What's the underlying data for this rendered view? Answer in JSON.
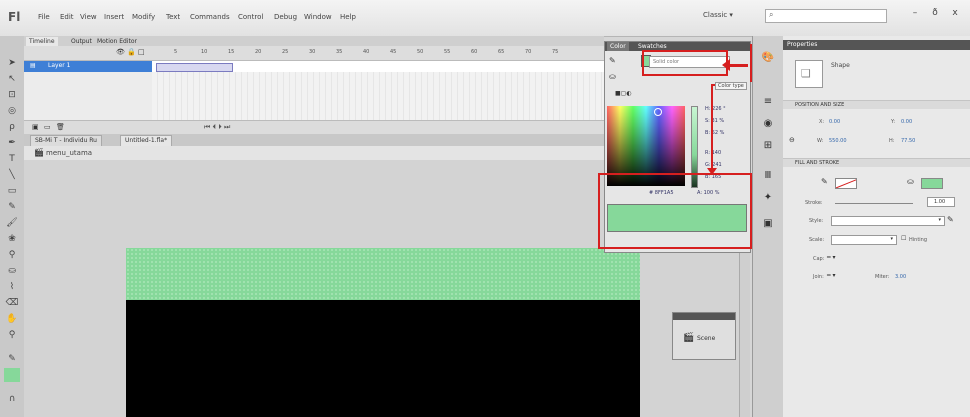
{
  "app": {
    "logo": "Fl"
  },
  "menu": [
    "File",
    "Edit",
    "View",
    "Insert",
    "Modify",
    "Text",
    "Commands",
    "Control",
    "Debug",
    "Window",
    "Help"
  ],
  "workspace": "Classic ▾",
  "window_controls": {
    "minimize": "–",
    "restore": "ð",
    "close": "x"
  },
  "timeline": {
    "tabs": [
      "Timeline",
      "Output",
      "Motion Editor"
    ],
    "frame_numbers": [
      "5",
      "10",
      "15",
      "20",
      "25",
      "30",
      "35",
      "40",
      "45",
      "50",
      "55",
      "60",
      "65",
      "70",
      "75"
    ],
    "layer_name": "Layer 1"
  },
  "doc_tabs": [
    "SB-Mi T - Individu Ru",
    "Untitled-1.fla*"
  ],
  "scene": {
    "label": "menu_utama"
  },
  "color_panel": {
    "tabs": [
      "Color",
      "Swatches"
    ],
    "color_type": "Solid color",
    "color_type_tip": "Color type",
    "rows": [
      "H: 226 °",
      "S: 31 %",
      "B: 52 %",
      "R: 140",
      "G: 241",
      "B: 165"
    ],
    "hex": "# 8FF1A5",
    "alpha": "A: 100 %"
  },
  "properties": {
    "tab_label": "Properties",
    "type": "Shape",
    "section_position": "POSITION AND SIZE",
    "x_label": "X:",
    "x_value": "0.00",
    "y_label": "Y:",
    "y_value": "0.00",
    "w_label": "W:",
    "w_value": "550.00",
    "h_label": "H:",
    "h_value": "77.50",
    "section_fill": "FILL AND STROKE",
    "stroke_label": "Stroke:",
    "stroke_value": "1.00",
    "style_label": "Style:",
    "scale_label": "Scale:",
    "hinting_label": "Hinting",
    "cap_label": "Cap:",
    "join_label": "Join:",
    "miter_label": "Miter:",
    "miter_value": "3.00"
  },
  "scene_panel": {
    "label": "Scene"
  },
  "colors": {
    "fill": "#86d89a",
    "annotation": "#d61f1f",
    "stage": "#000000"
  }
}
